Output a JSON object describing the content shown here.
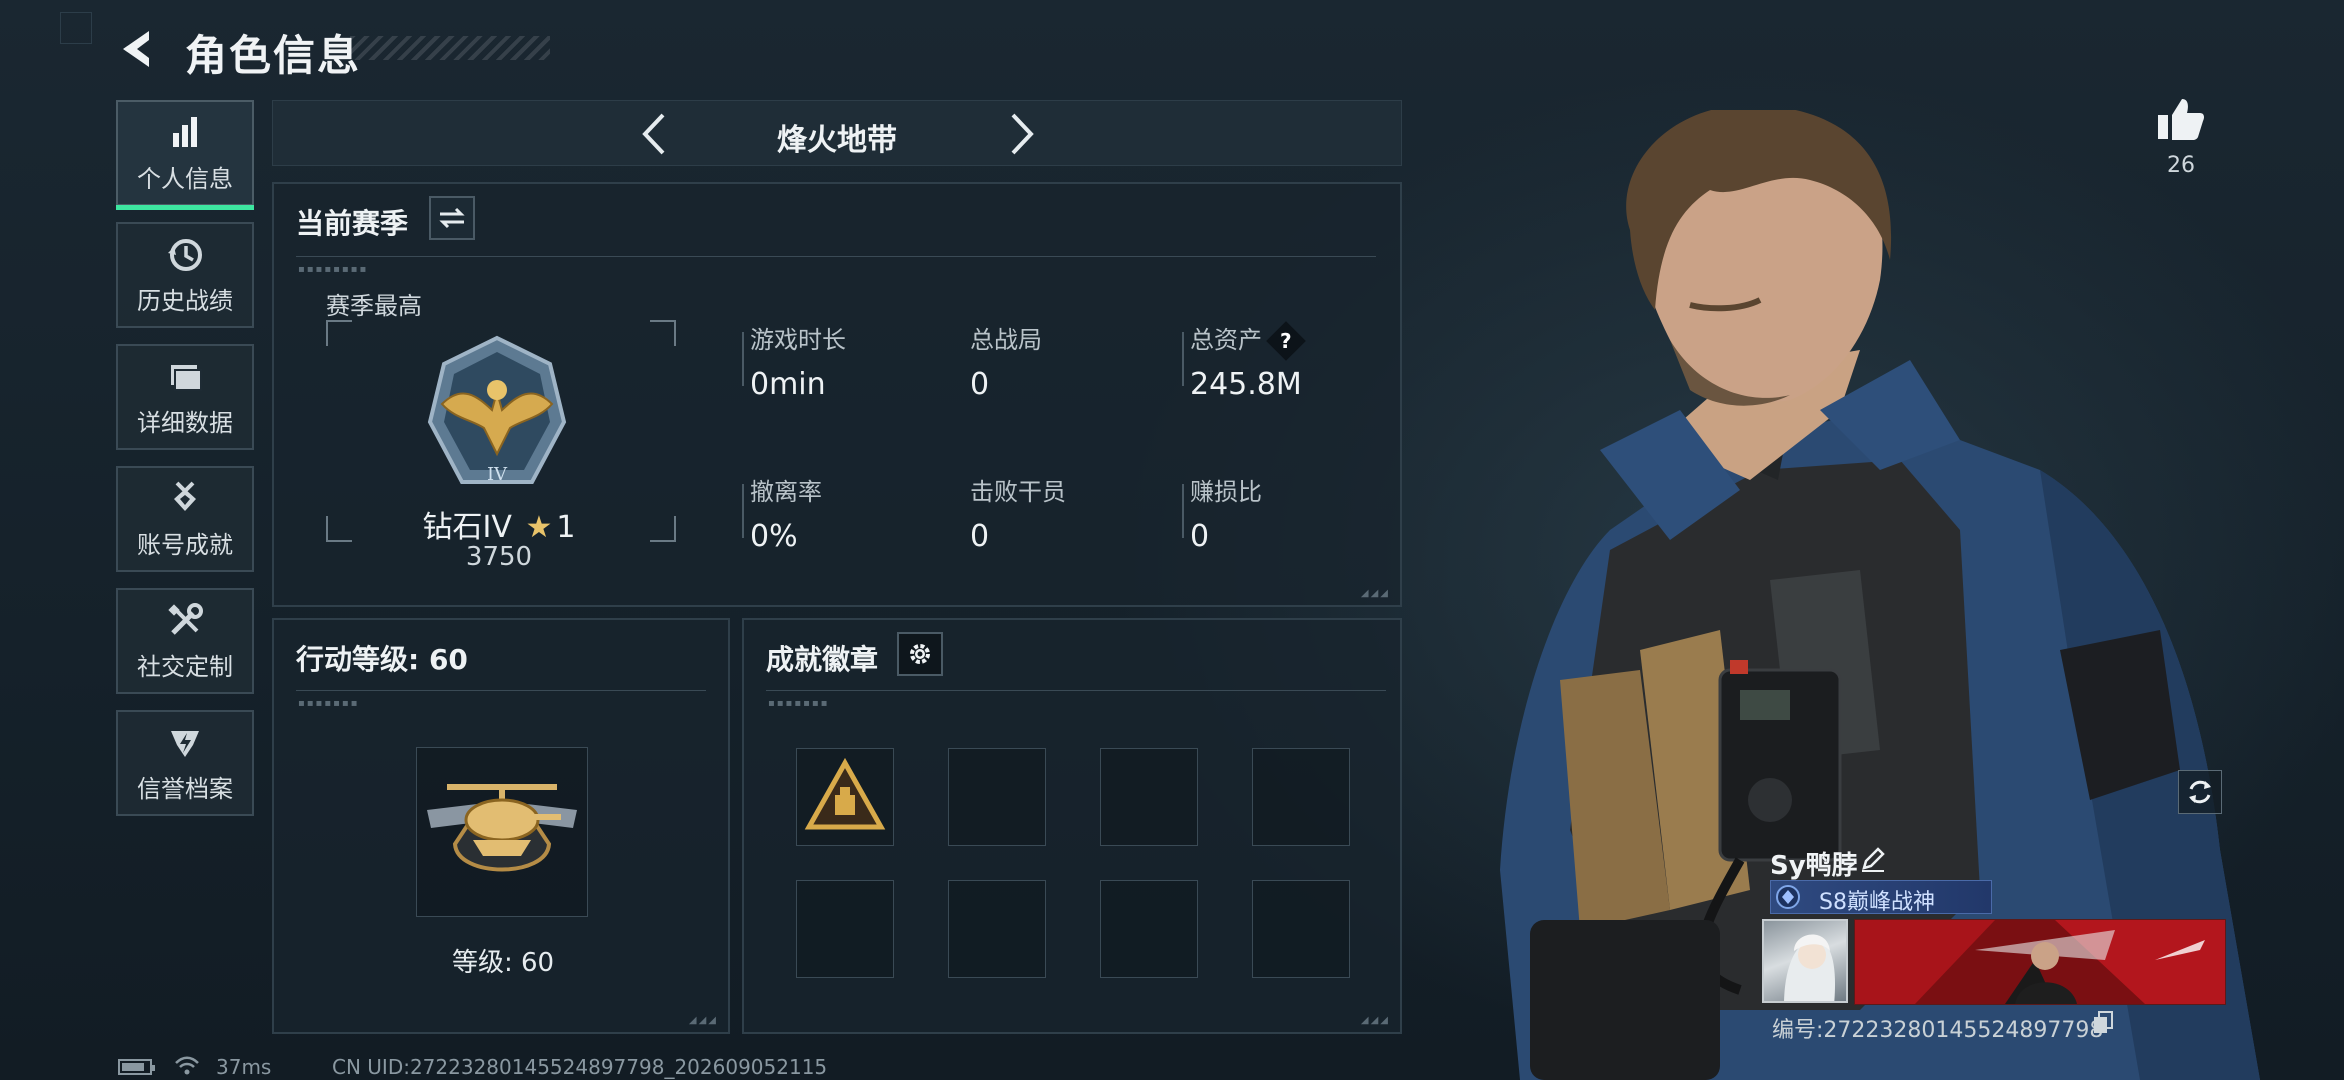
{
  "header": {
    "title": "角色信息"
  },
  "sidebar": {
    "items": [
      {
        "label": "个人信息",
        "icon": "bar-chart-icon",
        "active": true
      },
      {
        "label": "历史战绩",
        "icon": "history-clock-icon"
      },
      {
        "label": "详细数据",
        "icon": "folder-icon"
      },
      {
        "label": "账号成就",
        "icon": "medal-icon"
      },
      {
        "label": "社交定制",
        "icon": "tools-icon"
      },
      {
        "label": "信誉档案",
        "icon": "shield-emblem-icon"
      }
    ],
    "active_color": "#3de6a0"
  },
  "mode": {
    "title": "烽火地带"
  },
  "season": {
    "heading": "当前赛季",
    "best_label": "赛季最高",
    "rank_name": "钻石IV",
    "rank_stars": "1",
    "rank_score": "3750",
    "stats": [
      {
        "label": "游戏时长",
        "value": "0min"
      },
      {
        "label": "总战局",
        "value": "0"
      },
      {
        "label": "总资产",
        "value": "245.8M",
        "help": "?"
      },
      {
        "label": "撤离率",
        "value": "0%"
      },
      {
        "label": "击败干员",
        "value": "0"
      },
      {
        "label": "赚损比",
        "value": "0"
      }
    ]
  },
  "level": {
    "heading": "行动等级: 60",
    "badge_label": "等级: 60"
  },
  "achievements": {
    "heading": "成就徽章",
    "slots_filled": 1,
    "slots_total": 8
  },
  "likes": {
    "count": "26"
  },
  "player": {
    "name": "Sy鸭脖",
    "title": "S8巅峰战神",
    "id_label": "编号:27223280145524897798"
  },
  "status": {
    "ping": "37ms",
    "uid": "CN UID:27223280145524897798_202609052115"
  }
}
